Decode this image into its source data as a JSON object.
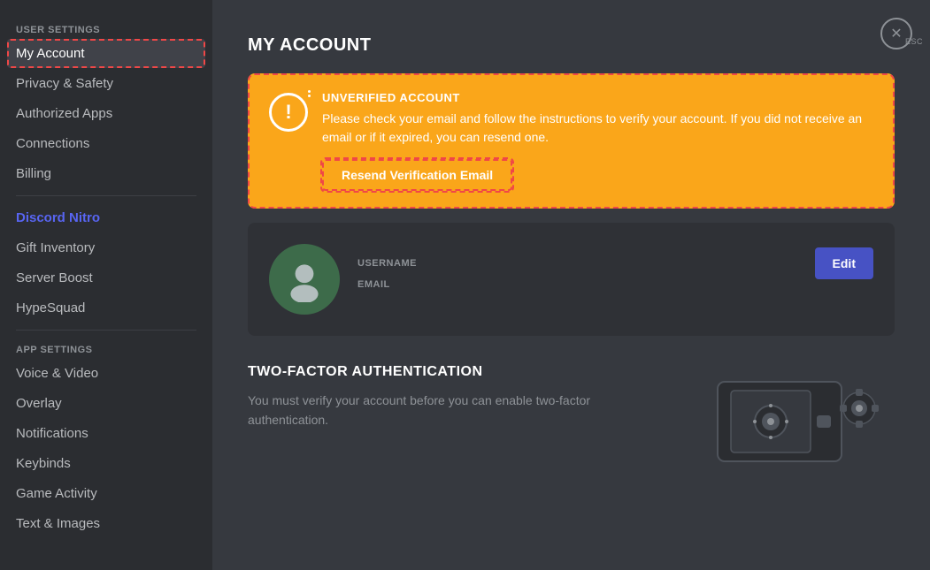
{
  "sidebar": {
    "userSettings": {
      "label": "USER SETTINGS"
    },
    "items": [
      {
        "id": "my-account",
        "label": "My Account",
        "active": true,
        "highlight": false
      },
      {
        "id": "privacy-safety",
        "label": "Privacy & Safety",
        "active": false,
        "highlight": false
      },
      {
        "id": "authorized-apps",
        "label": "Authorized Apps",
        "active": false,
        "highlight": false
      },
      {
        "id": "connections",
        "label": "Connections",
        "active": false,
        "highlight": false
      },
      {
        "id": "billing",
        "label": "Billing",
        "active": false,
        "highlight": false
      }
    ],
    "discordNitro": {
      "label": "Discord Nitro",
      "highlight": true
    },
    "nitroItems": [
      {
        "id": "gift-inventory",
        "label": "Gift Inventory"
      },
      {
        "id": "server-boost",
        "label": "Server Boost"
      },
      {
        "id": "hypesquad",
        "label": "HypeSquad"
      }
    ],
    "appSettings": {
      "label": "APP SETTINGS"
    },
    "appItems": [
      {
        "id": "voice-video",
        "label": "Voice & Video"
      },
      {
        "id": "overlay",
        "label": "Overlay"
      },
      {
        "id": "notifications",
        "label": "Notifications"
      },
      {
        "id": "keybinds",
        "label": "Keybinds"
      },
      {
        "id": "game-activity",
        "label": "Game Activity"
      },
      {
        "id": "text-images",
        "label": "Text & Images"
      }
    ]
  },
  "main": {
    "title": "MY ACCOUNT",
    "warning": {
      "title": "UNVERIFIED ACCOUNT",
      "description": "Please check your email and follow the instructions to verify your account. If you did not receive an email or if it expired, you can resend one.",
      "resendLabel": "Resend Verification Email"
    },
    "account": {
      "usernameLabel": "USERNAME",
      "emailLabel": "EMAIL",
      "editLabel": "Edit"
    },
    "twoFactor": {
      "title": "TWO-FACTOR AUTHENTICATION",
      "description": "You must verify your account before you can enable two-factor authentication."
    }
  },
  "closeButton": {
    "label": "ESC"
  }
}
